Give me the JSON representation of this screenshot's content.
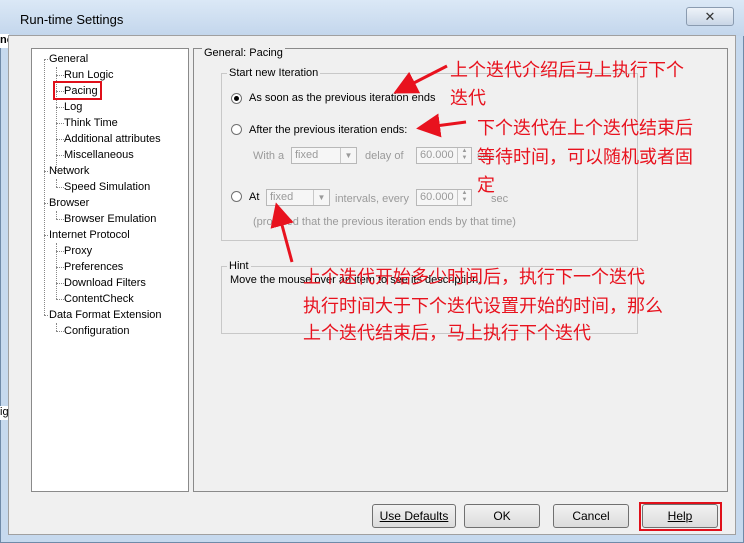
{
  "window": {
    "title": "Run-time Settings",
    "close_symbol": "✕"
  },
  "background_slivers": {
    "top_left": "no",
    "left_mid": "ig"
  },
  "tree": {
    "items": [
      {
        "label": "General",
        "level": 0
      },
      {
        "label": "Run Logic",
        "level": 1
      },
      {
        "label": "Pacing",
        "level": 1,
        "selected": true
      },
      {
        "label": "Log",
        "level": 1
      },
      {
        "label": "Think Time",
        "level": 1
      },
      {
        "label": "Additional attributes",
        "level": 1
      },
      {
        "label": "Miscellaneous",
        "level": 1
      },
      {
        "label": "Network",
        "level": 0
      },
      {
        "label": "Speed Simulation",
        "level": 1
      },
      {
        "label": "Browser",
        "level": 0
      },
      {
        "label": "Browser Emulation",
        "level": 1
      },
      {
        "label": "Internet Protocol",
        "level": 0
      },
      {
        "label": "Proxy",
        "level": 1
      },
      {
        "label": "Preferences",
        "level": 1
      },
      {
        "label": "Download Filters",
        "level": 1
      },
      {
        "label": "ContentCheck",
        "level": 1
      },
      {
        "label": "Data Format Extension",
        "level": 0
      },
      {
        "label": "Configuration",
        "level": 1
      }
    ]
  },
  "panel": {
    "title": "General: Pacing",
    "start_group": "Start new Iteration",
    "opt1": "As soon as the previous iteration ends",
    "opt2": "After the previous iteration ends:",
    "with_a": "With a",
    "combo1": "fixed",
    "delay_of": "delay of",
    "spin1": "60.000",
    "sec1": "sec",
    "opt3": "At",
    "combo2": "fixed",
    "intervals_every": "intervals, every",
    "spin2": "60.000",
    "sec2": "sec",
    "provided": "(provided that the previous iteration ends by that time)",
    "hint_title": "Hint",
    "hint_text": "Move the mouse over an item to see its description."
  },
  "buttons": {
    "defaults": "Use Defaults",
    "ok": "OK",
    "cancel": "Cancel",
    "help": "Help"
  },
  "annotations": {
    "a1_l1": "上个迭代介绍后马上执行下个",
    "a1_l2": "迭代",
    "a2_l1": "下个迭代在上个迭代结束后",
    "a2_l2": "等待时间，可以随机或者固",
    "a2_l3": "定",
    "a3_l1": "上个迭代开始多少时间后，执行下一个迭代",
    "a3_l2": "执行时间大于下个迭代设置开始的时间，那么",
    "a3_l3": "上个迭代结束后，马上执行下个迭代"
  },
  "colors": {
    "annotation": "#e8121e",
    "frame": "#c6d9ee"
  }
}
